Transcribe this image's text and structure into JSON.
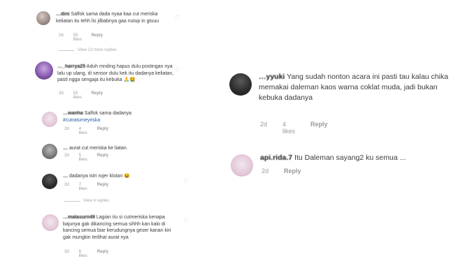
{
  "left_comments": [
    {
      "username": "…dini",
      "text": "Salfok sama dada nyaa kaa cut meriska keliatan itu tehh lis jilbabnya gaa nutup in gtuuu",
      "time": "2d",
      "likes": "53 likes",
      "reply": "Reply"
    },
    {
      "username": "…_harrya25",
      "text": "Aduh mnding hapus dulu postingan nya lalu up ulang, di sensor dulu kek itu dadanya keliatan, pasti ngga sengaja itu kebuka 🙏😭",
      "time": "2d",
      "likes": "53 likes",
      "reply": "Reply"
    },
    {
      "username": "…wanha",
      "text": "Salfok sama dadanya",
      "hashtag": "#cutratumeyriska",
      "time": "2d",
      "likes": "4 likes",
      "reply": "Reply"
    },
    {
      "username": "…",
      "text": "aurat cut meriska ke liatan.",
      "time": "2d",
      "likes": "5 likes",
      "reply": "Reply"
    },
    {
      "username": "…",
      "text": "dadanya istri rojer klotan 😆",
      "time": "2d",
      "likes": "7 likes",
      "reply": "Reply"
    },
    {
      "username": "…malasurn49",
      "text": "Lagian itu si cutmeriska kenapa bajunya gak dikancing semua sihhh kan kalo di kancing semua biar kerudungnya geser kanan kiri gak mungkin terlihat aurat nya",
      "time": "2d",
      "likes": "6 likes",
      "reply": "Reply"
    }
  ],
  "view_replies": [
    "View 13 more replies",
    "View 4 replies"
  ],
  "right_comments": [
    {
      "username": "…yyuki",
      "text": "Yang sudah nonton acara ini pasti tau kalau chika memakai daleman kaos warna coklat muda, jadi bukan kebuka dadanya",
      "time": "2d",
      "likes": "4 likes",
      "reply": "Reply"
    },
    {
      "username": "api.rida.7",
      "text": "Itu Daleman sayang2 ku semua ...",
      "time": "2d",
      "likes": "",
      "reply": "Reply"
    }
  ],
  "icons": {
    "heart": "heart-outline-icon"
  }
}
